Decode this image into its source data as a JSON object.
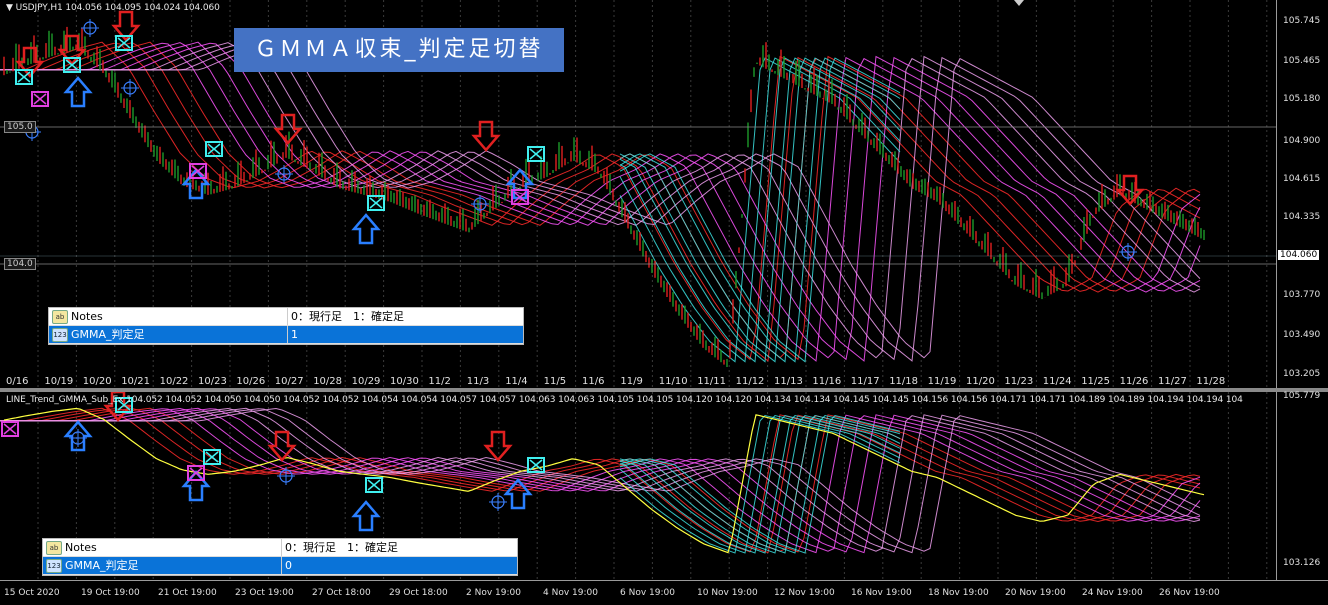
{
  "main": {
    "title": "▼ USDJPY,H1  104.056 104.095 104.024 104.060",
    "overlay_title": "ＧＭＭＡ収束_判定足切替",
    "price_ticks": [
      "105.745",
      "105.465",
      "105.180",
      "104.900",
      "104.615",
      "104.335",
      "104.060",
      "103.770",
      "103.490",
      "103.205"
    ],
    "current_price": "104.060",
    "level_labels": [
      "105.0",
      "104.0"
    ],
    "date_labels": [
      "0/16",
      "10/19",
      "10/20",
      "10/21",
      "10/22",
      "10/23",
      "10/26",
      "10/27",
      "10/28",
      "10/29",
      "10/30",
      "11/2",
      "11/3",
      "11/4",
      "11/5",
      "11/6",
      "11/9",
      "11/10",
      "11/11",
      "11/12",
      "11/13",
      "11/16",
      "11/17",
      "11/18",
      "11/19",
      "11/20",
      "11/23",
      "11/24",
      "11/25",
      "11/26",
      "11/27",
      "11/28"
    ],
    "inputs": [
      {
        "icon": "ab",
        "name": "Notes",
        "value": "0：現行足　1：確定足"
      },
      {
        "icon": "123",
        "name": "GMMA_判定足",
        "value": "1"
      }
    ]
  },
  "sub": {
    "title": "LINE_Trend_GMMA_Sub_Ex 104.052 104.052 104.050 104.050 104.052 104.052 104.054 104.054 104.057 104.057 104.063 104.063 104.105 104.105 104.120 104.120 104.134 104.134 104.145 104.145 104.156 104.156 104.171 104.171 104.189 104.189 104.194 104.194 104",
    "price_ticks": [
      "105.779",
      "103.126"
    ],
    "inputs": [
      {
        "icon": "ab",
        "name": "Notes",
        "value": "0：現行足　1：確定足"
      },
      {
        "icon": "123",
        "name": "GMMA_判定足",
        "value": "0"
      }
    ]
  },
  "time_axis": [
    "15 Oct 2020",
    "19 Oct 19:00",
    "21 Oct 19:00",
    "23 Oct 19:00",
    "27 Oct 18:00",
    "29 Oct 18:00",
    "2 Nov 19:00",
    "4 Nov 19:00",
    "6 Nov 19:00",
    "10 Nov 19:00",
    "12 Nov 19:00",
    "16 Nov 19:00",
    "18 Nov 19:00",
    "20 Nov 19:00",
    "24 Nov 19:00",
    "26 Nov 19:00"
  ],
  "colors": {
    "bull": "#1c9a2a",
    "bear": "#e02020",
    "short_ema": "#ff3030",
    "long_ema": "#ff60ff",
    "up_ema": "#40f0f0",
    "sell_arrow": "#e02020",
    "buy_arrow": "#2a7fff"
  },
  "chart_data": {
    "type": "line",
    "title": "USDJPY,H1",
    "series": [
      {
        "name": "USDJPY",
        "values": [
          105.4,
          105.48,
          105.55,
          105.6,
          105.42,
          105.1,
          104.8,
          104.62,
          104.55,
          104.6,
          104.7,
          104.82,
          104.72,
          104.6,
          104.55,
          104.5,
          104.42,
          104.35,
          104.28,
          104.45,
          104.6,
          104.68,
          104.8,
          104.7,
          104.35,
          104.0,
          103.7,
          103.45,
          103.3,
          105.5,
          105.4,
          105.3,
          105.2,
          105.0,
          104.8,
          104.6,
          104.5,
          104.3,
          104.1,
          103.9,
          103.8,
          103.9,
          104.4,
          104.55,
          104.45,
          104.35,
          104.25,
          104.15,
          104.1,
          104.06
        ]
      }
    ],
    "ylim": [
      103.126,
      105.779
    ]
  }
}
